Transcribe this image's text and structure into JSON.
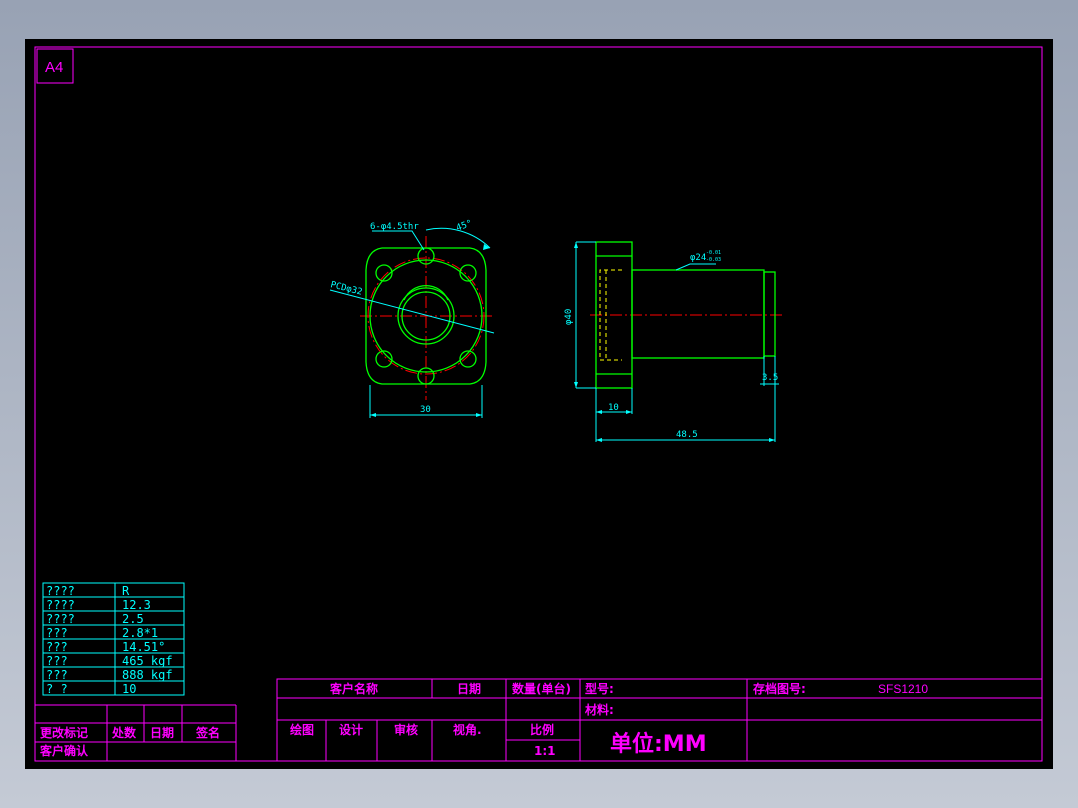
{
  "sheet": {
    "size_label": "A4",
    "colors": {
      "background": "#000000",
      "frame": "#ff00ff",
      "part": "#00ff00",
      "center": "#ff0000",
      "dim": "#00ffff",
      "hidden": "#ffff00",
      "text": "#ff00ff"
    }
  },
  "front_view": {
    "hole_callout": "6-φ4.5thr",
    "angle": "45°",
    "pcd": "PCDφ32",
    "width_dim": "30"
  },
  "side_view": {
    "flange_dia": "φ40",
    "shaft_dia": "φ24",
    "tol_upper": "-0.01",
    "tol_lower": "-0.03",
    "flange_thk": "10",
    "total_len": "48.5",
    "step_len": "3.5"
  },
  "spec_table": {
    "rows": [
      {
        "label": "????",
        "value": "R"
      },
      {
        "label": "????",
        "value": "12.3"
      },
      {
        "label": "????",
        "value": "2.5"
      },
      {
        "label": "???",
        "value": "2.8*1"
      },
      {
        "label": "???",
        "value": "14.51°"
      },
      {
        "label": "???",
        "value": "465 kgf"
      },
      {
        "label": "???",
        "value": "888 kgf"
      },
      {
        "label": "?  ?",
        "value": "10"
      }
    ]
  },
  "revision_block": {
    "change_mark": "更改标记",
    "count": "处数",
    "date": "日期",
    "signature": "签名",
    "customer_confirm": "客户确认"
  },
  "title_block": {
    "customer_name": "客户名称",
    "date": "日期",
    "quantity": "数量(单台)",
    "model": "型号:",
    "archive_no": "存档图号:",
    "archive_value": "SFS1210",
    "material": "材料:",
    "drawn": "绘图",
    "design": "设计",
    "review": "审核",
    "view_angle": "视角.",
    "scale": "比例",
    "scale_value": "1:1",
    "unit": "单位:MM"
  }
}
